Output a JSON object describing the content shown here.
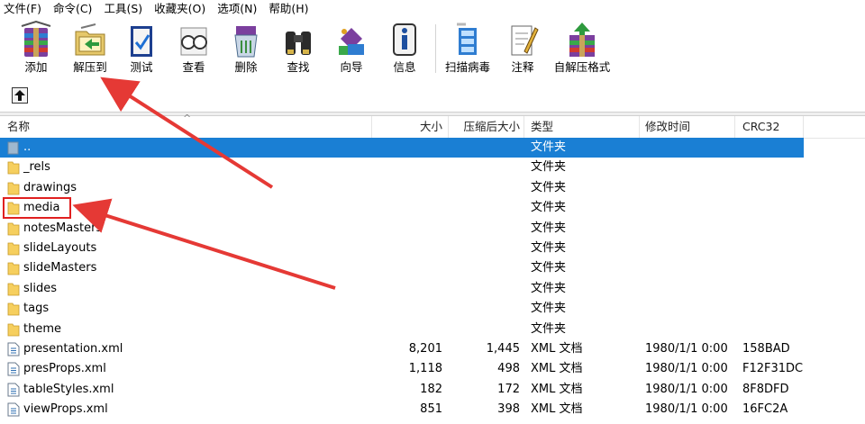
{
  "menu": [
    "文件(F)",
    "命令(C)",
    "工具(S)",
    "收藏夹(O)",
    "选项(N)",
    "帮助(H)"
  ],
  "toolbar": {
    "add": "添加",
    "extract": "解压到",
    "test": "测试",
    "view": "查看",
    "delete": "删除",
    "find": "查找",
    "wizard": "向导",
    "info": "信息",
    "scan": "扫描病毒",
    "comment": "注释",
    "sfx": "自解压格式"
  },
  "columns": {
    "name": "名称",
    "size": "大小",
    "packed": "压缩后大小",
    "type": "类型",
    "modified": "修改时间",
    "crc": "CRC32"
  },
  "files": [
    {
      "name": "..",
      "size": "",
      "packed": "",
      "type": "文件夹",
      "modified": "",
      "crc": "",
      "kind": "parent",
      "selected": true
    },
    {
      "name": "_rels",
      "size": "",
      "packed": "",
      "type": "文件夹",
      "modified": "",
      "crc": "",
      "kind": "folder"
    },
    {
      "name": "drawings",
      "size": "",
      "packed": "",
      "type": "文件夹",
      "modified": "",
      "crc": "",
      "kind": "folder"
    },
    {
      "name": "media",
      "size": "",
      "packed": "",
      "type": "文件夹",
      "modified": "",
      "crc": "",
      "kind": "folder"
    },
    {
      "name": "notesMasters",
      "size": "",
      "packed": "",
      "type": "文件夹",
      "modified": "",
      "crc": "",
      "kind": "folder"
    },
    {
      "name": "slideLayouts",
      "size": "",
      "packed": "",
      "type": "文件夹",
      "modified": "",
      "crc": "",
      "kind": "folder"
    },
    {
      "name": "slideMasters",
      "size": "",
      "packed": "",
      "type": "文件夹",
      "modified": "",
      "crc": "",
      "kind": "folder"
    },
    {
      "name": "slides",
      "size": "",
      "packed": "",
      "type": "文件夹",
      "modified": "",
      "crc": "",
      "kind": "folder"
    },
    {
      "name": "tags",
      "size": "",
      "packed": "",
      "type": "文件夹",
      "modified": "",
      "crc": "",
      "kind": "folder"
    },
    {
      "name": "theme",
      "size": "",
      "packed": "",
      "type": "文件夹",
      "modified": "",
      "crc": "",
      "kind": "folder"
    },
    {
      "name": "presentation.xml",
      "size": "8,201",
      "packed": "1,445",
      "type": "XML 文档",
      "modified": "1980/1/1 0:00",
      "crc": "158BAD",
      "kind": "xml"
    },
    {
      "name": "presProps.xml",
      "size": "1,118",
      "packed": "498",
      "type": "XML 文档",
      "modified": "1980/1/1 0:00",
      "crc": "F12F31DC",
      "kind": "xml"
    },
    {
      "name": "tableStyles.xml",
      "size": "182",
      "packed": "172",
      "type": "XML 文档",
      "modified": "1980/1/1 0:00",
      "crc": "8F8DFD",
      "kind": "xml"
    },
    {
      "name": "viewProps.xml",
      "size": "851",
      "packed": "398",
      "type": "XML 文档",
      "modified": "1980/1/1 0:00",
      "crc": "16FC2A",
      "kind": "xml"
    }
  ],
  "colors": {
    "selection": "#1a7fd4",
    "folder": "#f6cf5e",
    "annotation": "#e53935"
  }
}
